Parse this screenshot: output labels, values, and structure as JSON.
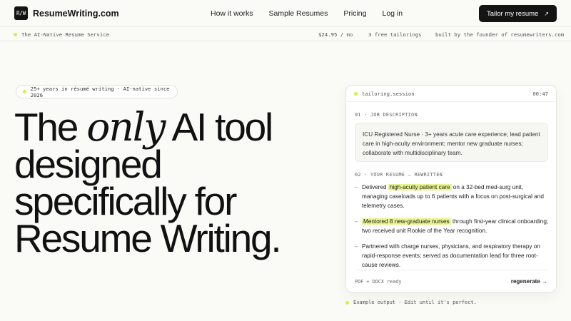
{
  "nav": {
    "logo_mark": "R/W",
    "brand": "ResumeWriting.com",
    "links": [
      "How it works",
      "Sample Resumes",
      "Pricing",
      "Log in"
    ],
    "cta_label": "Tailor my resume",
    "cta_arrow": "↗"
  },
  "status": {
    "tagline": "The AI-Native Resume Service",
    "price": "$24.95 / mo",
    "tailorings": "3 free tailorings",
    "built_by": "built by the founder of resumewriters.com"
  },
  "hero": {
    "badge": "25+ years in résumé writing · AI-native since 2026",
    "headline_pre": "The ",
    "headline_only": "only",
    "headline_post": " AI tool designed specifically for Resume Writing."
  },
  "card": {
    "title": "tailoring.session",
    "time": "00:47",
    "jd_label": "01 · JOB DESCRIPTION",
    "jd_text": "ICU Registered Nurse · 3+ years acute care experience; lead patient care in high-acuity environment; mentor new graduate nurses; collaborate with multidisciplinary team.",
    "resume_label": "02 · YOUR RESUME — REWRITTEN",
    "bullet_mark": "–",
    "bullets": [
      {
        "pre": "Delivered ",
        "hl": "high-acuity patient care",
        "post": " on a 32-bed med-surg unit, managing caseloads up to 6 patients with a focus on post-surgical and telemetry cases."
      },
      {
        "pre": "",
        "hl": "Mentored 8 new-graduate nurses",
        "post": " through first-year clinical onboarding; two received unit Rookie of the Year recognition."
      },
      {
        "pre": "Partnered with charge nurses, physicians, and respiratory therapy on rapid-response events; served as documentation lead for three root-cause reviews.",
        "hl": "",
        "post": ""
      }
    ],
    "footer_left": "PDF + DOCX ready",
    "footer_right": "regenerate →"
  },
  "caption": "Example output · Edit until it's perfect.",
  "colors": {
    "accent": "#d9ec4f",
    "highlight": "#e9f48f",
    "dark": "#141414",
    "background": "#fafaf7"
  }
}
